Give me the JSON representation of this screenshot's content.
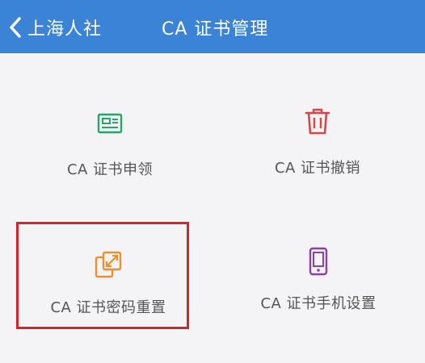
{
  "header": {
    "back_label": "上海人社",
    "title": "CA 证书管理",
    "color": "#3b83d6"
  },
  "tiles": [
    {
      "label": "CA 证书申领",
      "icon": "id-card-icon",
      "color": "#23a56e"
    },
    {
      "label": "CA 证书撤销",
      "icon": "trash-icon",
      "color": "#d94646"
    },
    {
      "label": "CA 证书密码重置",
      "icon": "password-reset-icon",
      "color": "#e89132"
    },
    {
      "label": "CA 证书手机设置",
      "icon": "mobile-phone-icon",
      "color": "#8e3fa8"
    }
  ],
  "highlight": {
    "color": "#d5252c",
    "target": "CA 证书密码重置"
  }
}
